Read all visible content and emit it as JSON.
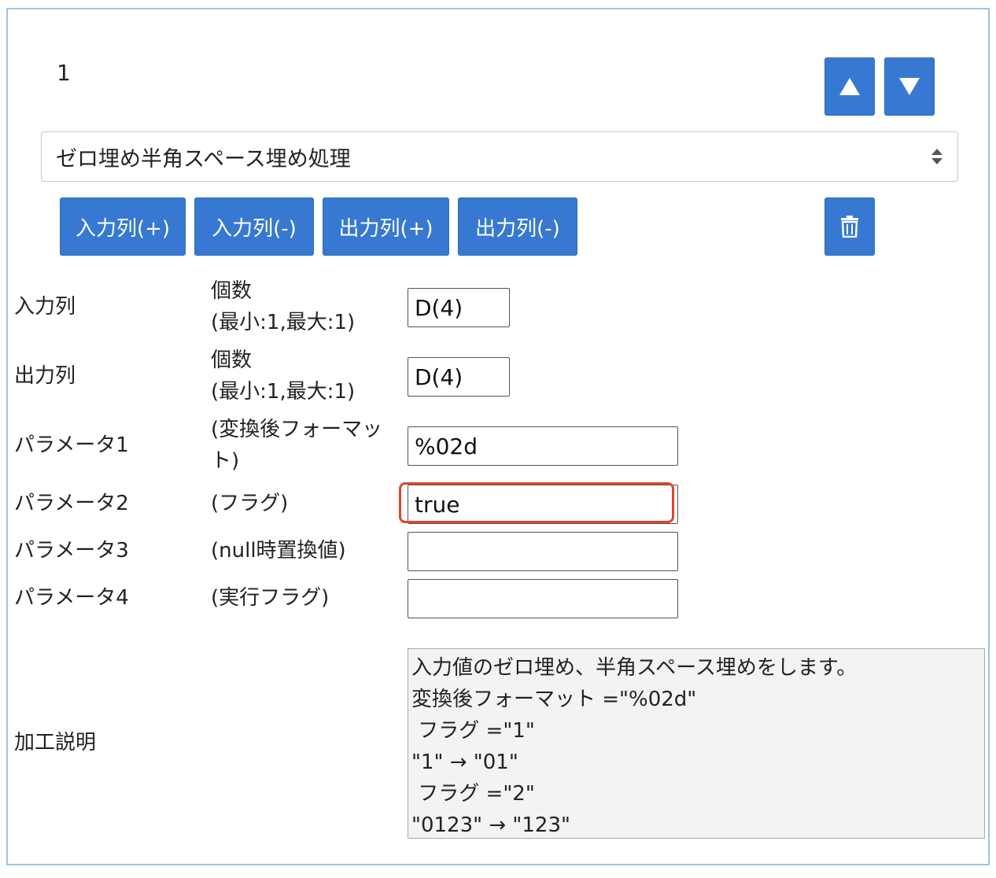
{
  "step": {
    "number": "1"
  },
  "controls": {
    "move_up_icon": "triangle-up",
    "move_down_icon": "triangle-down",
    "delete_icon": "trash"
  },
  "processing": {
    "selected": "ゼロ埋め半角スペース埋め処理"
  },
  "buttons": {
    "input_add": "入力列(+)",
    "input_remove": "入力列(-)",
    "output_add": "出力列(+)",
    "output_remove": "出力列(-)"
  },
  "rows": {
    "input_col": {
      "label": "入力列",
      "sub_line1": "個数",
      "sub_line2": "(最小:1,最大:1)",
      "value": "D(4)"
    },
    "output_col": {
      "label": "出力列",
      "sub_line1": "個数",
      "sub_line2": "(最小:1,最大:1)",
      "value": "D(4)"
    },
    "param1": {
      "label": "パラメータ1",
      "sub_line1": "(変換後フォーマッ",
      "sub_line2": "ト)",
      "value": "%02d"
    },
    "param2": {
      "label": "パラメータ2",
      "sub": "(フラグ)",
      "value": "true"
    },
    "param3": {
      "label": "パラメータ3",
      "sub": "(null時置換値)",
      "value": ""
    },
    "param4": {
      "label": "パラメータ4",
      "sub": "(実行フラグ)",
      "value": ""
    }
  },
  "description": {
    "label": "加工説明",
    "text": "入力値のゼロ埋め、半角スペース埋めをします。\n変換後フォーマット =\"%02d\"\n フラグ =\"1\"\n\"1\" → \"01\"\n フラグ =\"2\"\n\"0123\" → \"123\""
  },
  "colors": {
    "primary_button": "#3779d2",
    "panel_border": "#9cc3e8",
    "highlight": "#e0452d",
    "description_bg": "#f3f3f3"
  }
}
